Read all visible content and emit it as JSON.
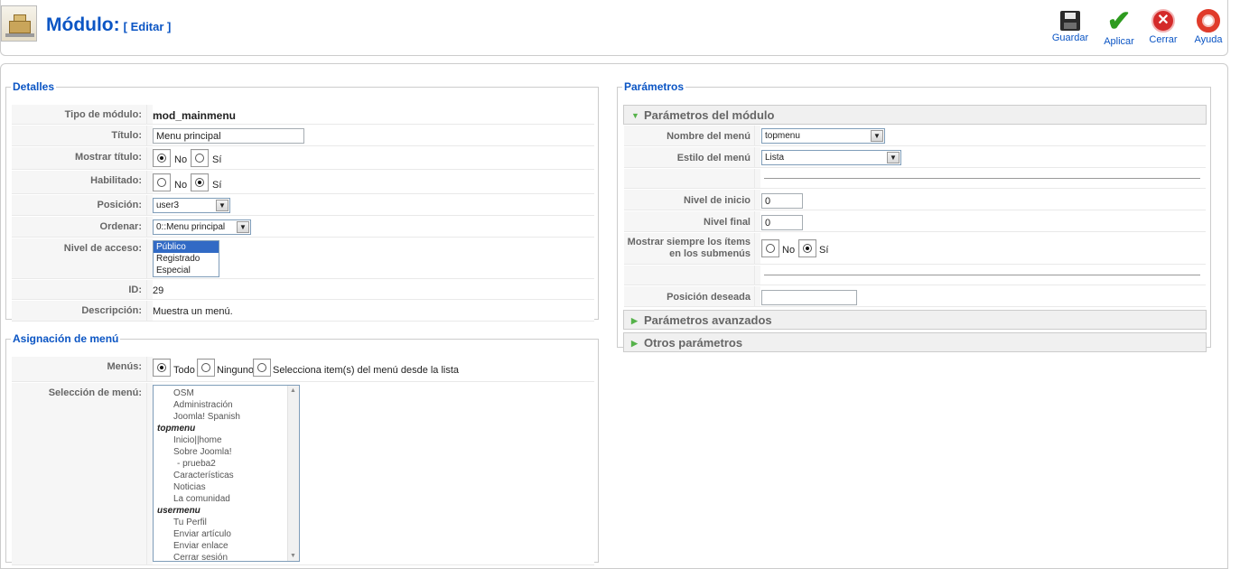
{
  "header": {
    "title": "Módulo:",
    "subtitle": "[ Editar ]",
    "buttons": {
      "save": "Guardar",
      "apply": "Aplicar",
      "close": "Cerrar",
      "help": "Ayuda"
    }
  },
  "details": {
    "legend": "Detalles",
    "module_type_label": "Tipo de módulo:",
    "module_type_value": "mod_mainmenu",
    "title_label": "Título:",
    "title_value": "Menu principal",
    "show_title_label": "Mostrar título:",
    "show_title_no": "No",
    "show_title_yes": "Sí",
    "enabled_label": "Habilitado:",
    "enabled_no": "No",
    "enabled_yes": "Sí",
    "position_label": "Posición:",
    "position_value": "user3",
    "order_label": "Ordenar:",
    "order_value": "0::Menu principal",
    "access_label": "Nivel de acceso:",
    "access_options": [
      "Público",
      "Registrado",
      "Especial"
    ],
    "id_label": "ID:",
    "id_value": "29",
    "description_label": "Descripción:",
    "description_value": "Muestra un menú."
  },
  "menu_assignment": {
    "legend": "Asignación de menú",
    "menus_label": "Menús:",
    "opt_all": "Todo",
    "opt_none": "Ninguno",
    "opt_select": "Selecciona item(s) del menú desde la lista",
    "selection_label": "Selección de menú:",
    "items": [
      "OSM",
      "Administración",
      "Joomla! Spanish"
    ],
    "group_top": "topmenu",
    "top_items": [
      "Inicio||home",
      "Sobre Joomla!",
      "- prueba2",
      "Características",
      "Noticias",
      "La comunidad"
    ],
    "group_user": "usermenu",
    "user_items": [
      "Tu Perfil",
      "Enviar artículo",
      "Enviar enlace",
      "Cerrar sesión"
    ]
  },
  "parameters": {
    "legend": "Parámetros",
    "module_params": "Parámetros del módulo",
    "menu_name_label": "Nombre del menú",
    "menu_name_value": "topmenu",
    "menu_style_label": "Estilo del menú",
    "menu_style_value": "Lista",
    "start_level_label": "Nivel de inicio",
    "start_level_value": "0",
    "end_level_label": "Nivel final",
    "end_level_value": "0",
    "always_show_label": "Mostrar siempre los ítems en los submenús",
    "always_show_no": "No",
    "always_show_yes": "Sí",
    "target_position_label": "Posición deseada",
    "target_position_value": "",
    "advanced_params": "Parámetros avanzados",
    "other_params": "Otros parámetros"
  }
}
